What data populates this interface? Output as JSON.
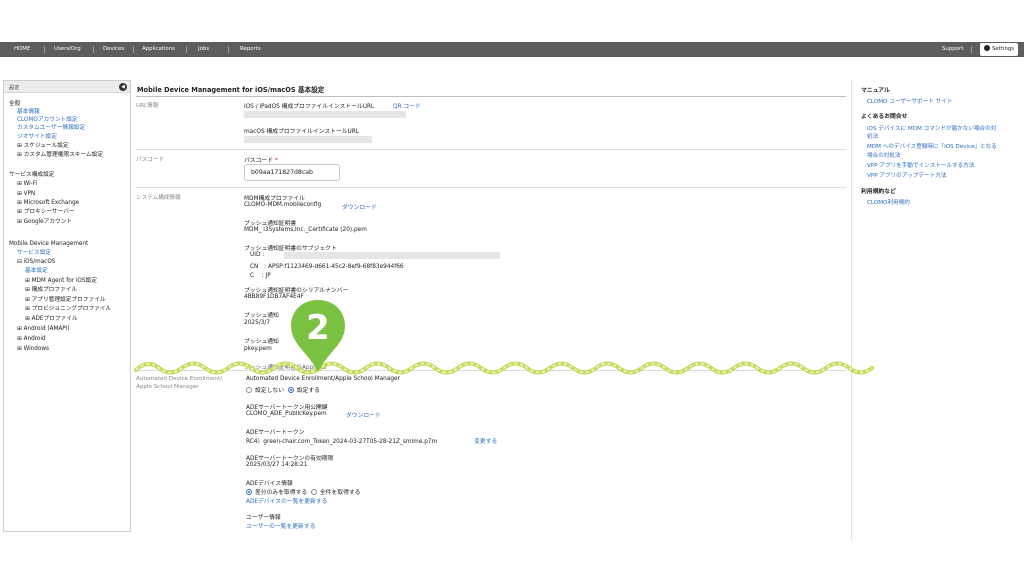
{
  "nav": {
    "items": [
      "HOME",
      "Users/Org",
      "Devices",
      "Applications",
      "Jobs",
      "Reports"
    ],
    "support": "Support",
    "settings": "Settings"
  },
  "sidebar": {
    "header": "設定",
    "general_heading": "全般",
    "general_items": [
      "基本情報",
      "CLOMOアカウント設定",
      "カスタムユーザー情報設定",
      "ジオサイト設定"
    ],
    "general_expandables": [
      "スケジュール設定",
      "カスタム管理権限スキーム設定"
    ],
    "service_heading": "サービス構成設定",
    "service_items": [
      "Wi-Fi",
      "VPN",
      "Microsoft Exchange",
      "プロキシーサーバー",
      "Googleアカウント"
    ],
    "mdm_heading": "Mobile Device Management",
    "mdm_service": "サービス設定",
    "ios": "iOS/macOS",
    "ios_basic": "基本設定",
    "ios_children": [
      "MDM Agent for iOS設定",
      "構成プロファイル",
      "アプリ管理設定プロファイル",
      "プロビジョニングプロファイル",
      "ADEプロファイル"
    ],
    "platforms": [
      "Android (AMAPI)",
      "Android",
      "Windows"
    ]
  },
  "main": {
    "title": "Mobile Device Management for iOS/macOS 基本設定",
    "url_label": "URL情報",
    "ios_url_label": "iOS / iPadOS 構成プロファイルインストールURL",
    "qr": "QR コード",
    "macos_url_label": "macOS 構成プロファイルインストールURL",
    "passcode_label": "パスコード",
    "passcode_field": "パスコード",
    "required_mark": "*",
    "passcode_value": "b09aa171827d8cab",
    "system_label": "システム構成情報",
    "mdm_profile_label": "MDM構成プロファイル",
    "mdm_profile_file": "CLOMO-MDM.mobileconfig",
    "download": "ダウンロード",
    "push_cert_label": "プッシュ通知証明書",
    "push_cert_file": "MDM_ i3Systems,Inc._Certificate (20).pem",
    "push_subject_label": "プッシュ通知証明書のサブジェクト",
    "uid_label": "UID :",
    "cn_row": "CN　:  APSP:f1123469-d661-45c2-8ef9-68f83e944f66",
    "c_row": "C　 :  JP",
    "serial_label": "プッシュ通知証明書のシリアルナンバー",
    "serial_value": "4BB89F1DB7AF4E4F",
    "expiry_label": "プッシュ通知",
    "expiry_value": "2025/3/7",
    "key_label": "プッシュ通知",
    "key_value": "pkey.pem",
    "partial_line": "プッシュ通知証明書のApple ID",
    "ade_label_1": "Automated Device Enrollment/",
    "ade_label_2": "Apple School Manager",
    "ade_title": "Automated Device Enrollment/Apple School Manager",
    "radio_off": "設定しない",
    "radio_on": "設定する",
    "ade_pubkey_label": "ADEサーバートークン用公開鍵",
    "ade_pubkey_file": "CLOMO_ADE_PublicKey.pem",
    "ade_token_label": "ADEサーバートークン",
    "ade_token_file": "RC4）green-chair.com_Token_2024-03-27T05-28-21Z_smime.p7m",
    "change": "変更する",
    "ade_expiry_label": "ADEサーバートークンの有効期限",
    "ade_expiry_value": "2025/03/27 14:28:21",
    "ade_device_label": "ADEデバイス情報",
    "diff_option": "差分のみを取得する",
    "all_option": "全件を取得する",
    "update_devices": "ADEデバイスの一覧を更新する",
    "user_info_label": "ユーザー情報",
    "update_users": "ユーザーの一覧を更新する"
  },
  "right": {
    "manual_heading": "マニュアル",
    "manual_link": "CLOMO ユーザーサポート サイト",
    "faq_heading": "よくあるお問合せ",
    "faq_links": [
      "iOS デバイスに MDM コマンドが届かない場合の対",
      "処法",
      "MDM へのデバイス登録時に「iOS Device」となる",
      "場合の対処法",
      "VPP アプリを手動でインストールする方法",
      "VPP アプリのアップデート方法"
    ],
    "terms_heading": "利用規約など",
    "terms_link": "CLOMO利用規約"
  },
  "annotation": {
    "step": "2"
  },
  "colors": {
    "link": "#2a6cc2",
    "nav": "#5d5d5d",
    "marker": "#7cc242",
    "wave": "#c3dc5a"
  }
}
